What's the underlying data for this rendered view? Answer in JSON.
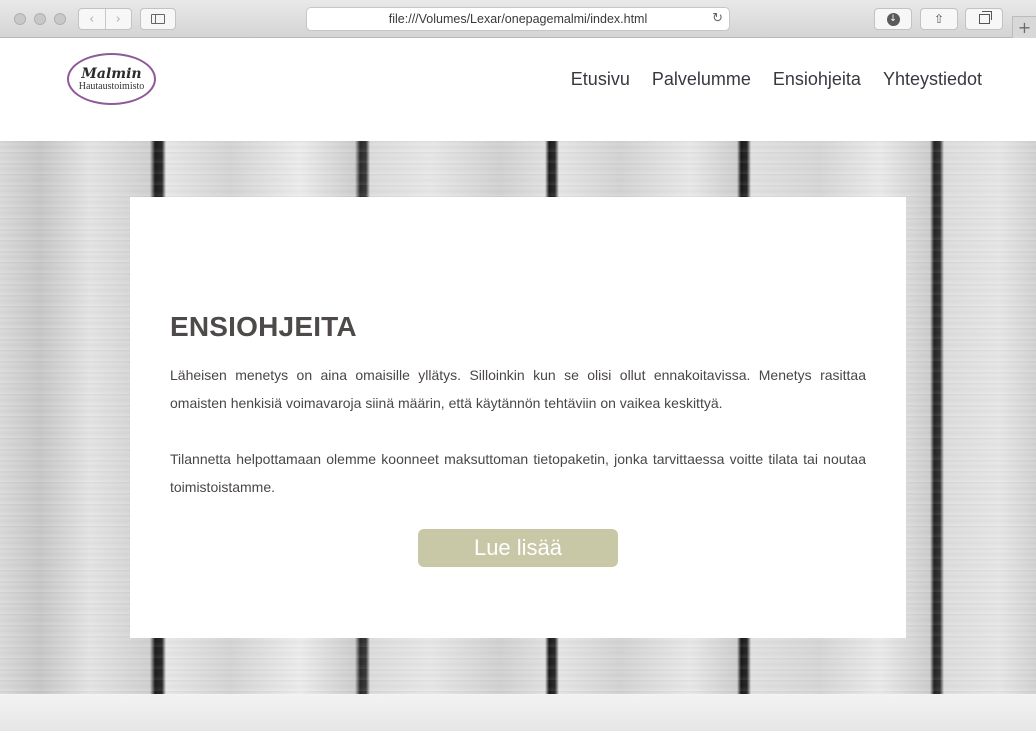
{
  "browser": {
    "back_glyph": "‹",
    "forward_glyph": "›",
    "address": "file:///Volumes/Lexar/onepagemalmi/index.html",
    "reload_glyph": "↻",
    "download_glyph": "↓",
    "share_glyph": "⇧",
    "newtab_glyph": "+",
    "icons": [
      "back-icon",
      "forward-icon",
      "sidebar-icon",
      "reload-icon",
      "download-icon",
      "share-icon",
      "tabs-icon",
      "new-tab-icon"
    ]
  },
  "site": {
    "logo": {
      "script": "Malmin",
      "sub": "Hautaustoimisto",
      "ring_color": "#8e5a97"
    },
    "nav": [
      {
        "label": "Etusivu"
      },
      {
        "label": "Palvelumme"
      },
      {
        "label": "Ensiohjeita"
      },
      {
        "label": "Yhteystiedot"
      }
    ]
  },
  "main": {
    "title": "ENSIOHJEITA",
    "paragraphs": [
      "Läheisen menetys on aina omaisille yllätys. Silloinkin kun se olisi ollut ennakoitavissa. Menetys rasittaa omaisten henkisiä voimavaroja siinä määrin, että käytännön tehtäviin on vaikea keskittyä.",
      "Tilannetta helpottamaan olemme koonneet maksuttoman tietopaketin, jonka tarvittaessa voitte tilata tai noutaa toimistoistamme."
    ],
    "cta_label": "Lue lisää",
    "cta_color": "#c9c8a6"
  }
}
